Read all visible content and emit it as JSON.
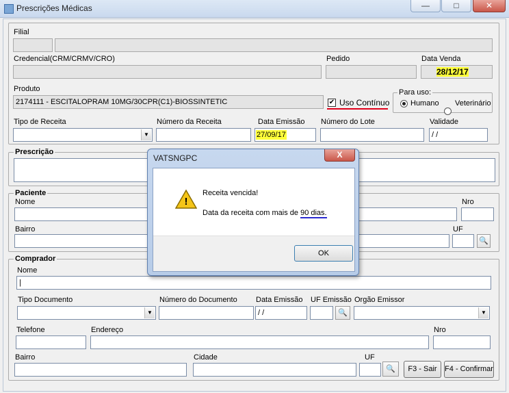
{
  "window": {
    "title": "Prescrições Médicas",
    "minimize": "—",
    "maximize": "□",
    "close": "✕"
  },
  "filial": {
    "label": "Filial",
    "code": "",
    "name": ""
  },
  "credencial": {
    "label": "Credencial(CRM/CRMV/CRO)",
    "value": ""
  },
  "pedido": {
    "label": "Pedido",
    "value": ""
  },
  "data_venda": {
    "label": "Data Venda",
    "value": "28/12/17"
  },
  "produto": {
    "label": "Produto",
    "value": "2174111 - ESCITALOPRAM 10MG/30CPR(C1)-BIOSSINTETIC"
  },
  "uso_continuo": {
    "label": "Uso Contínuo",
    "checked": true,
    "mark": "✔"
  },
  "para_uso": {
    "label": "Para uso:",
    "options": [
      "Humano",
      "Veterinário"
    ],
    "selected": "Humano"
  },
  "receita": {
    "tipo_label": "Tipo de Receita",
    "tipo_value": "",
    "numero_label": "Número da Receita",
    "numero_value": "",
    "emissao_label": "Data Emissão",
    "emissao_value": "27/09/17",
    "lote_label": "Número do Lote",
    "lote_value": "",
    "validade_label": "Validade",
    "validade_value": " / /"
  },
  "prescricao": {
    "title": "Prescrição",
    "value": ""
  },
  "paciente": {
    "title": "Paciente",
    "nome_label": "Nome",
    "nome_value": "",
    "nro_label": "Nro",
    "nro_value": "",
    "bairro_label": "Bairro",
    "bairro_value": "",
    "uf_label": "UF",
    "uf_value": ""
  },
  "comprador": {
    "title": "Comprador",
    "nome_label": "Nome",
    "nome_value": "|",
    "tipo_doc_label": "Tipo Documento",
    "tipo_doc_value": "",
    "num_doc_label": "Número do Documento",
    "num_doc_value": "",
    "data_emissao_label": "Data Emissão",
    "data_emissao_value": " / /",
    "uf_emissao_label": "UF Emissão",
    "uf_emissao_value": "",
    "orgao_label": "Orgão Emissor",
    "orgao_value": "",
    "telefone_label": "Telefone",
    "telefone_value": "",
    "endereco_label": "Endereço",
    "endereco_value": "",
    "nro_label": "Nro",
    "nro_value": "",
    "bairro_label": "Bairro",
    "bairro_value": "",
    "cidade_label": "Cidade",
    "cidade_value": "",
    "uf_label": "UF",
    "uf_value": ""
  },
  "buttons": {
    "sair": "F3 - Sair",
    "confirmar": "F4 - Confirmar",
    "search": "🔍"
  },
  "dialog": {
    "title": "VATSNGPC",
    "close": "X",
    "heading": "Receita vencida!",
    "message_prefix": "Data da receita com mais de ",
    "message_highlight": "90 dias.",
    "ok": "OK",
    "warning_glyph": "!"
  },
  "colors": {
    "highlight": "#ffff3a",
    "red_underline": "#e0001b",
    "blue_underline": "#2a2ad0",
    "titlebar": "#c9d9ee"
  }
}
